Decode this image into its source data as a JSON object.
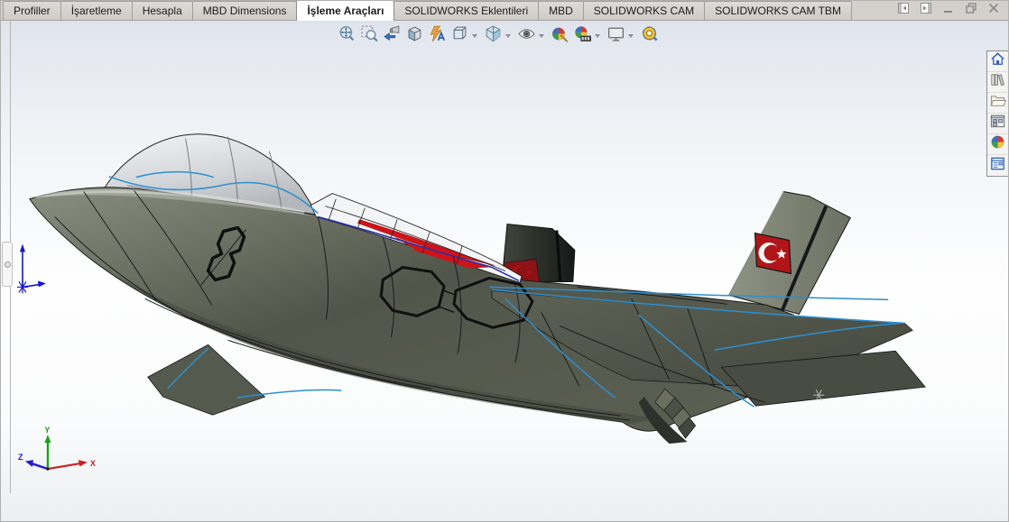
{
  "command_tabs": {
    "items": [
      {
        "label": "Profiller",
        "active": false
      },
      {
        "label": "İşaretleme",
        "active": false
      },
      {
        "label": "Hesapla",
        "active": false
      },
      {
        "label": "MBD Dimensions",
        "active": false
      },
      {
        "label": "İşleme Araçları",
        "active": true
      },
      {
        "label": "SOLIDWORKS Eklentileri",
        "active": false
      },
      {
        "label": "MBD",
        "active": false
      },
      {
        "label": "SOLIDWORKS CAM",
        "active": false
      },
      {
        "label": "SOLIDWORKS CAM TBM",
        "active": false
      }
    ]
  },
  "window_controls": {
    "items": [
      {
        "name": "previous-pane"
      },
      {
        "name": "next-pane"
      },
      {
        "name": "minimize"
      },
      {
        "name": "restore"
      },
      {
        "name": "close"
      }
    ]
  },
  "heads_up_toolbar": {
    "buttons": [
      {
        "name": "zoom-to-fit",
        "dropdown": false
      },
      {
        "name": "zoom-to-area",
        "dropdown": false
      },
      {
        "name": "previous-view",
        "dropdown": false
      },
      {
        "name": "section-view",
        "dropdown": false
      },
      {
        "name": "dynamic-annotation-views",
        "dropdown": false
      },
      {
        "name": "view-orientation",
        "dropdown": true
      },
      {
        "name": "display-style",
        "dropdown": true
      },
      {
        "name": "hide-show-items",
        "dropdown": true
      },
      {
        "name": "edit-appearance",
        "dropdown": false
      },
      {
        "name": "apply-scene",
        "dropdown": true
      },
      {
        "name": "view-settings",
        "dropdown": true
      },
      {
        "name": "measure",
        "dropdown": false
      }
    ]
  },
  "task_pane": {
    "tabs": [
      {
        "name": "solidworks-resources"
      },
      {
        "name": "design-library"
      },
      {
        "name": "file-explorer"
      },
      {
        "name": "view-palette"
      },
      {
        "name": "appearances-scenes"
      },
      {
        "name": "custom-properties"
      }
    ]
  },
  "viewport": {
    "axis_triad": {
      "x": "X",
      "y": "Y",
      "z": "Z",
      "x_color": "#cc2020",
      "y_color": "#18a018",
      "z_color": "#2020cc"
    },
    "model": {
      "name": "fighter-jet-assembly",
      "body_color": "#565b50",
      "canopy_color": "#d9dcde",
      "highlight_edge_color": "#2d8fd0",
      "selected_edge_color": "#2433a8",
      "flag_red": "#b0151a",
      "decal_red": "#cf1318"
    }
  }
}
